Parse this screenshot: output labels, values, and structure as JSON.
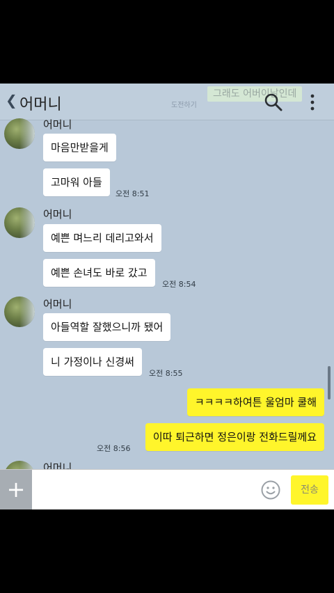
{
  "header": {
    "back_icon": "chevron-left-icon",
    "title": "어머니",
    "hint": "도전하기",
    "banner": "그래도 어버이날인데",
    "search_icon": "search-icon",
    "more_icon": "more-vertical-icon"
  },
  "messages": {
    "group0": {
      "sender": "어머니",
      "bubbles": [
        "마음만받을게",
        "고마워 아들"
      ],
      "time": "오전 8:51"
    },
    "group1": {
      "sender": "어머니",
      "bubbles": [
        "예쁜 며느리 데리고와서",
        "예쁜 손녀도 바로 갔고"
      ],
      "time": "오전 8:54"
    },
    "group2": {
      "sender": "어머니",
      "bubbles": [
        "아들역할 잘했으니까 됐어",
        "니 가정이나 신경써"
      ],
      "time": "오전 8:55"
    },
    "mine": {
      "bubbles": [
        "ㅋㅋㅋㅋ하여튼 울엄마 쿨해",
        "이따 퇴근하면 정은이랑 전화드릴께요"
      ],
      "time": "오전 8:56"
    },
    "group3": {
      "sender": "어머니"
    }
  },
  "input": {
    "placeholder": "",
    "send_label": "전송",
    "plus_icon": "plus-icon",
    "emoticon_icon": "smiley-icon"
  },
  "colors": {
    "chat_background": "#b8c8d8",
    "my_bubble": "#fff52b",
    "their_bubble": "#ffffff"
  }
}
